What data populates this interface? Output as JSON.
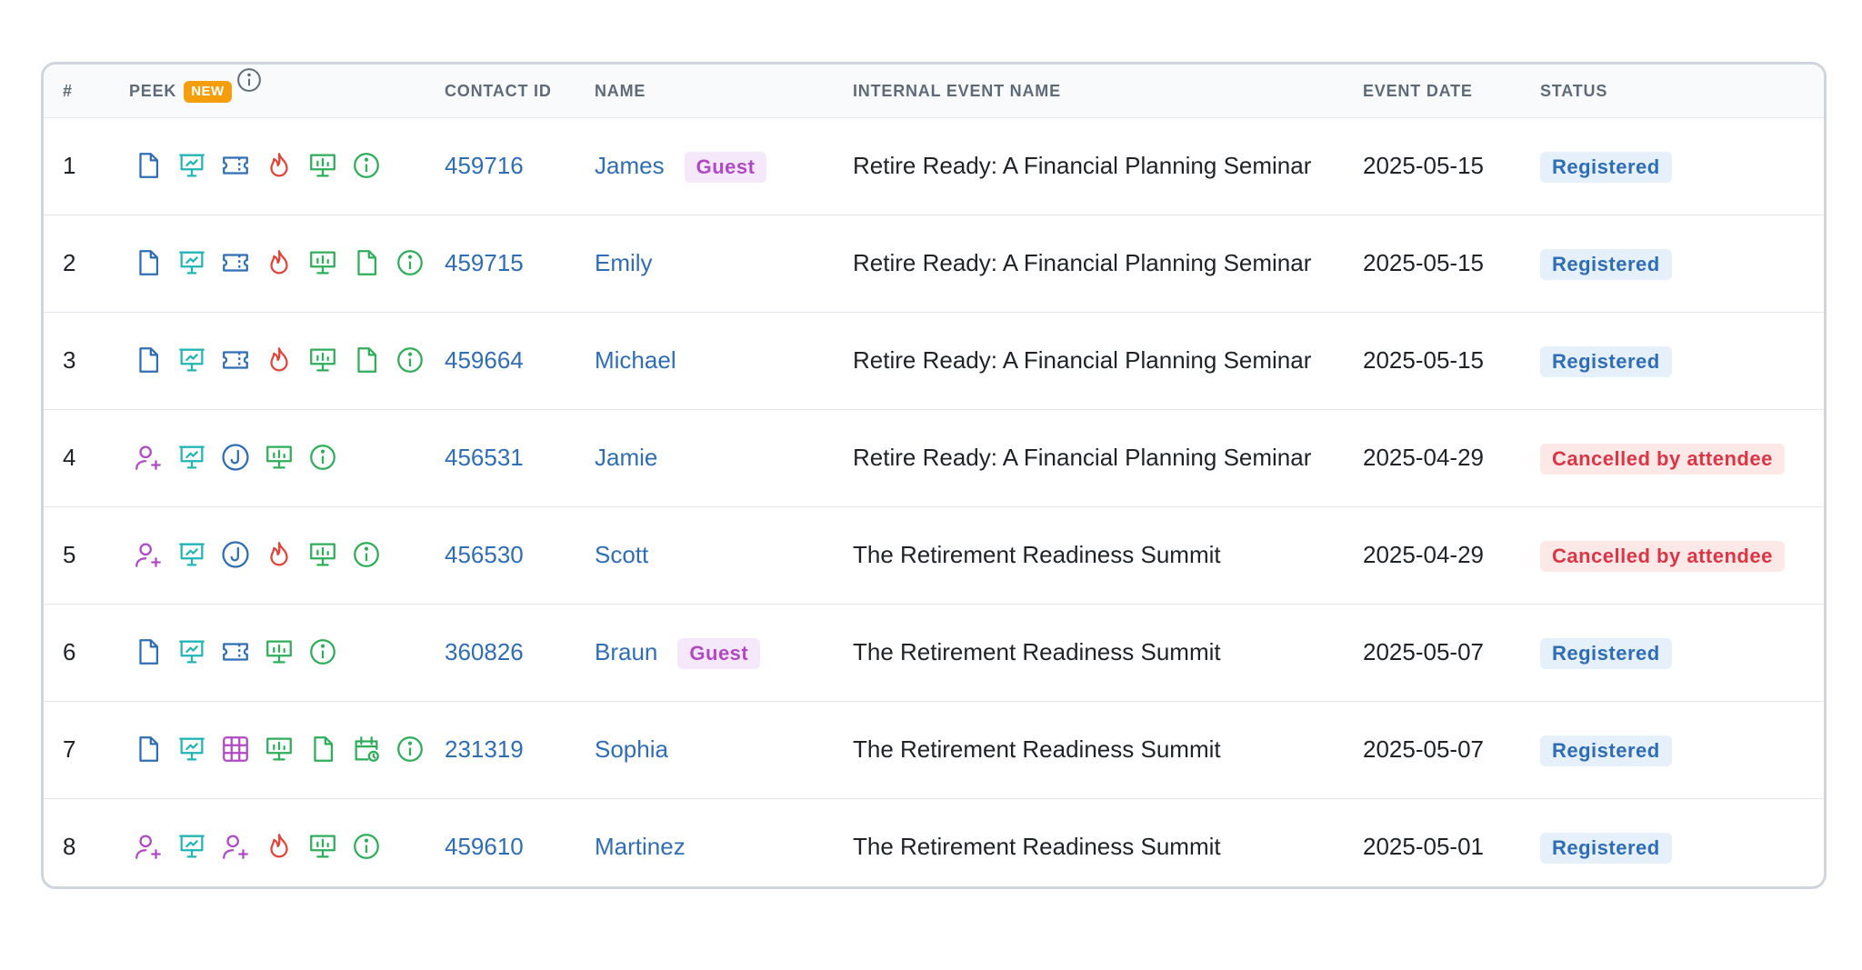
{
  "colors": {
    "blue": "#2f6db5",
    "teal": "#22b5b5",
    "red": "#e0453a",
    "green": "#2fae5a",
    "purple": "#b04ac4",
    "orange": "#f59e0b"
  },
  "header": {
    "num": "#",
    "peek": "PEEK",
    "new_badge": "NEW",
    "contact_id": "CONTACT ID",
    "name": "NAME",
    "event": "INTERNAL EVENT NAME",
    "date": "EVENT DATE",
    "status": "STATUS"
  },
  "rows": [
    {
      "num": "1",
      "peek": [
        "document",
        "presentation",
        "ticket",
        "fire",
        "whiteboard",
        "info"
      ],
      "contact_id": "459716",
      "name": "James",
      "guest": "Guest",
      "event": "Retire Ready: A Financial Planning Seminar",
      "date": "2025-05-15",
      "status": "Registered",
      "status_kind": "registered"
    },
    {
      "num": "2",
      "peek": [
        "document",
        "presentation",
        "ticket",
        "fire",
        "whiteboard",
        "document-green",
        "info"
      ],
      "contact_id": "459715",
      "name": "Emily",
      "guest": "",
      "event": "Retire Ready: A Financial Planning Seminar",
      "date": "2025-05-15",
      "status": "Registered",
      "status_kind": "registered"
    },
    {
      "num": "3",
      "peek": [
        "document",
        "presentation",
        "ticket",
        "fire",
        "whiteboard",
        "document-green",
        "info"
      ],
      "contact_id": "459664",
      "name": "Michael",
      "guest": "",
      "event": "Retire Ready: A Financial Planning Seminar",
      "date": "2025-05-15",
      "status": "Registered",
      "status_kind": "registered"
    },
    {
      "num": "4",
      "peek": [
        "user-plus",
        "presentation",
        "j-badge",
        "whiteboard",
        "info"
      ],
      "contact_id": "456531",
      "name": "Jamie",
      "guest": "",
      "event": "Retire Ready: A Financial Planning Seminar",
      "date": "2025-04-29",
      "status": "Cancelled by attendee",
      "status_kind": "cancelled"
    },
    {
      "num": "5",
      "peek": [
        "user-plus",
        "presentation",
        "j-badge",
        "fire",
        "whiteboard",
        "info"
      ],
      "contact_id": "456530",
      "name": "Scott",
      "guest": "",
      "event": "The Retirement Readiness Summit",
      "date": "2025-04-29",
      "status": "Cancelled by attendee",
      "status_kind": "cancelled"
    },
    {
      "num": "6",
      "peek": [
        "document",
        "presentation",
        "ticket",
        "whiteboard",
        "info"
      ],
      "contact_id": "360826",
      "name": "Braun",
      "guest": "Guest",
      "event": "The Retirement Readiness Summit",
      "date": "2025-05-07",
      "status": "Registered",
      "status_kind": "registered"
    },
    {
      "num": "7",
      "peek": [
        "document",
        "presentation",
        "grid",
        "whiteboard",
        "document-green",
        "calendar-clock",
        "info"
      ],
      "contact_id": "231319",
      "name": "Sophia",
      "guest": "",
      "event": "The Retirement Readiness Summit",
      "date": "2025-05-07",
      "status": "Registered",
      "status_kind": "registered"
    },
    {
      "num": "8",
      "peek": [
        "user-plus",
        "presentation",
        "user-plus",
        "fire",
        "whiteboard",
        "info"
      ],
      "contact_id": "459610",
      "name": "Martinez",
      "guest": "",
      "event": "The Retirement Readiness Summit",
      "date": "2025-05-01",
      "status": "Registered",
      "status_kind": "registered"
    }
  ]
}
